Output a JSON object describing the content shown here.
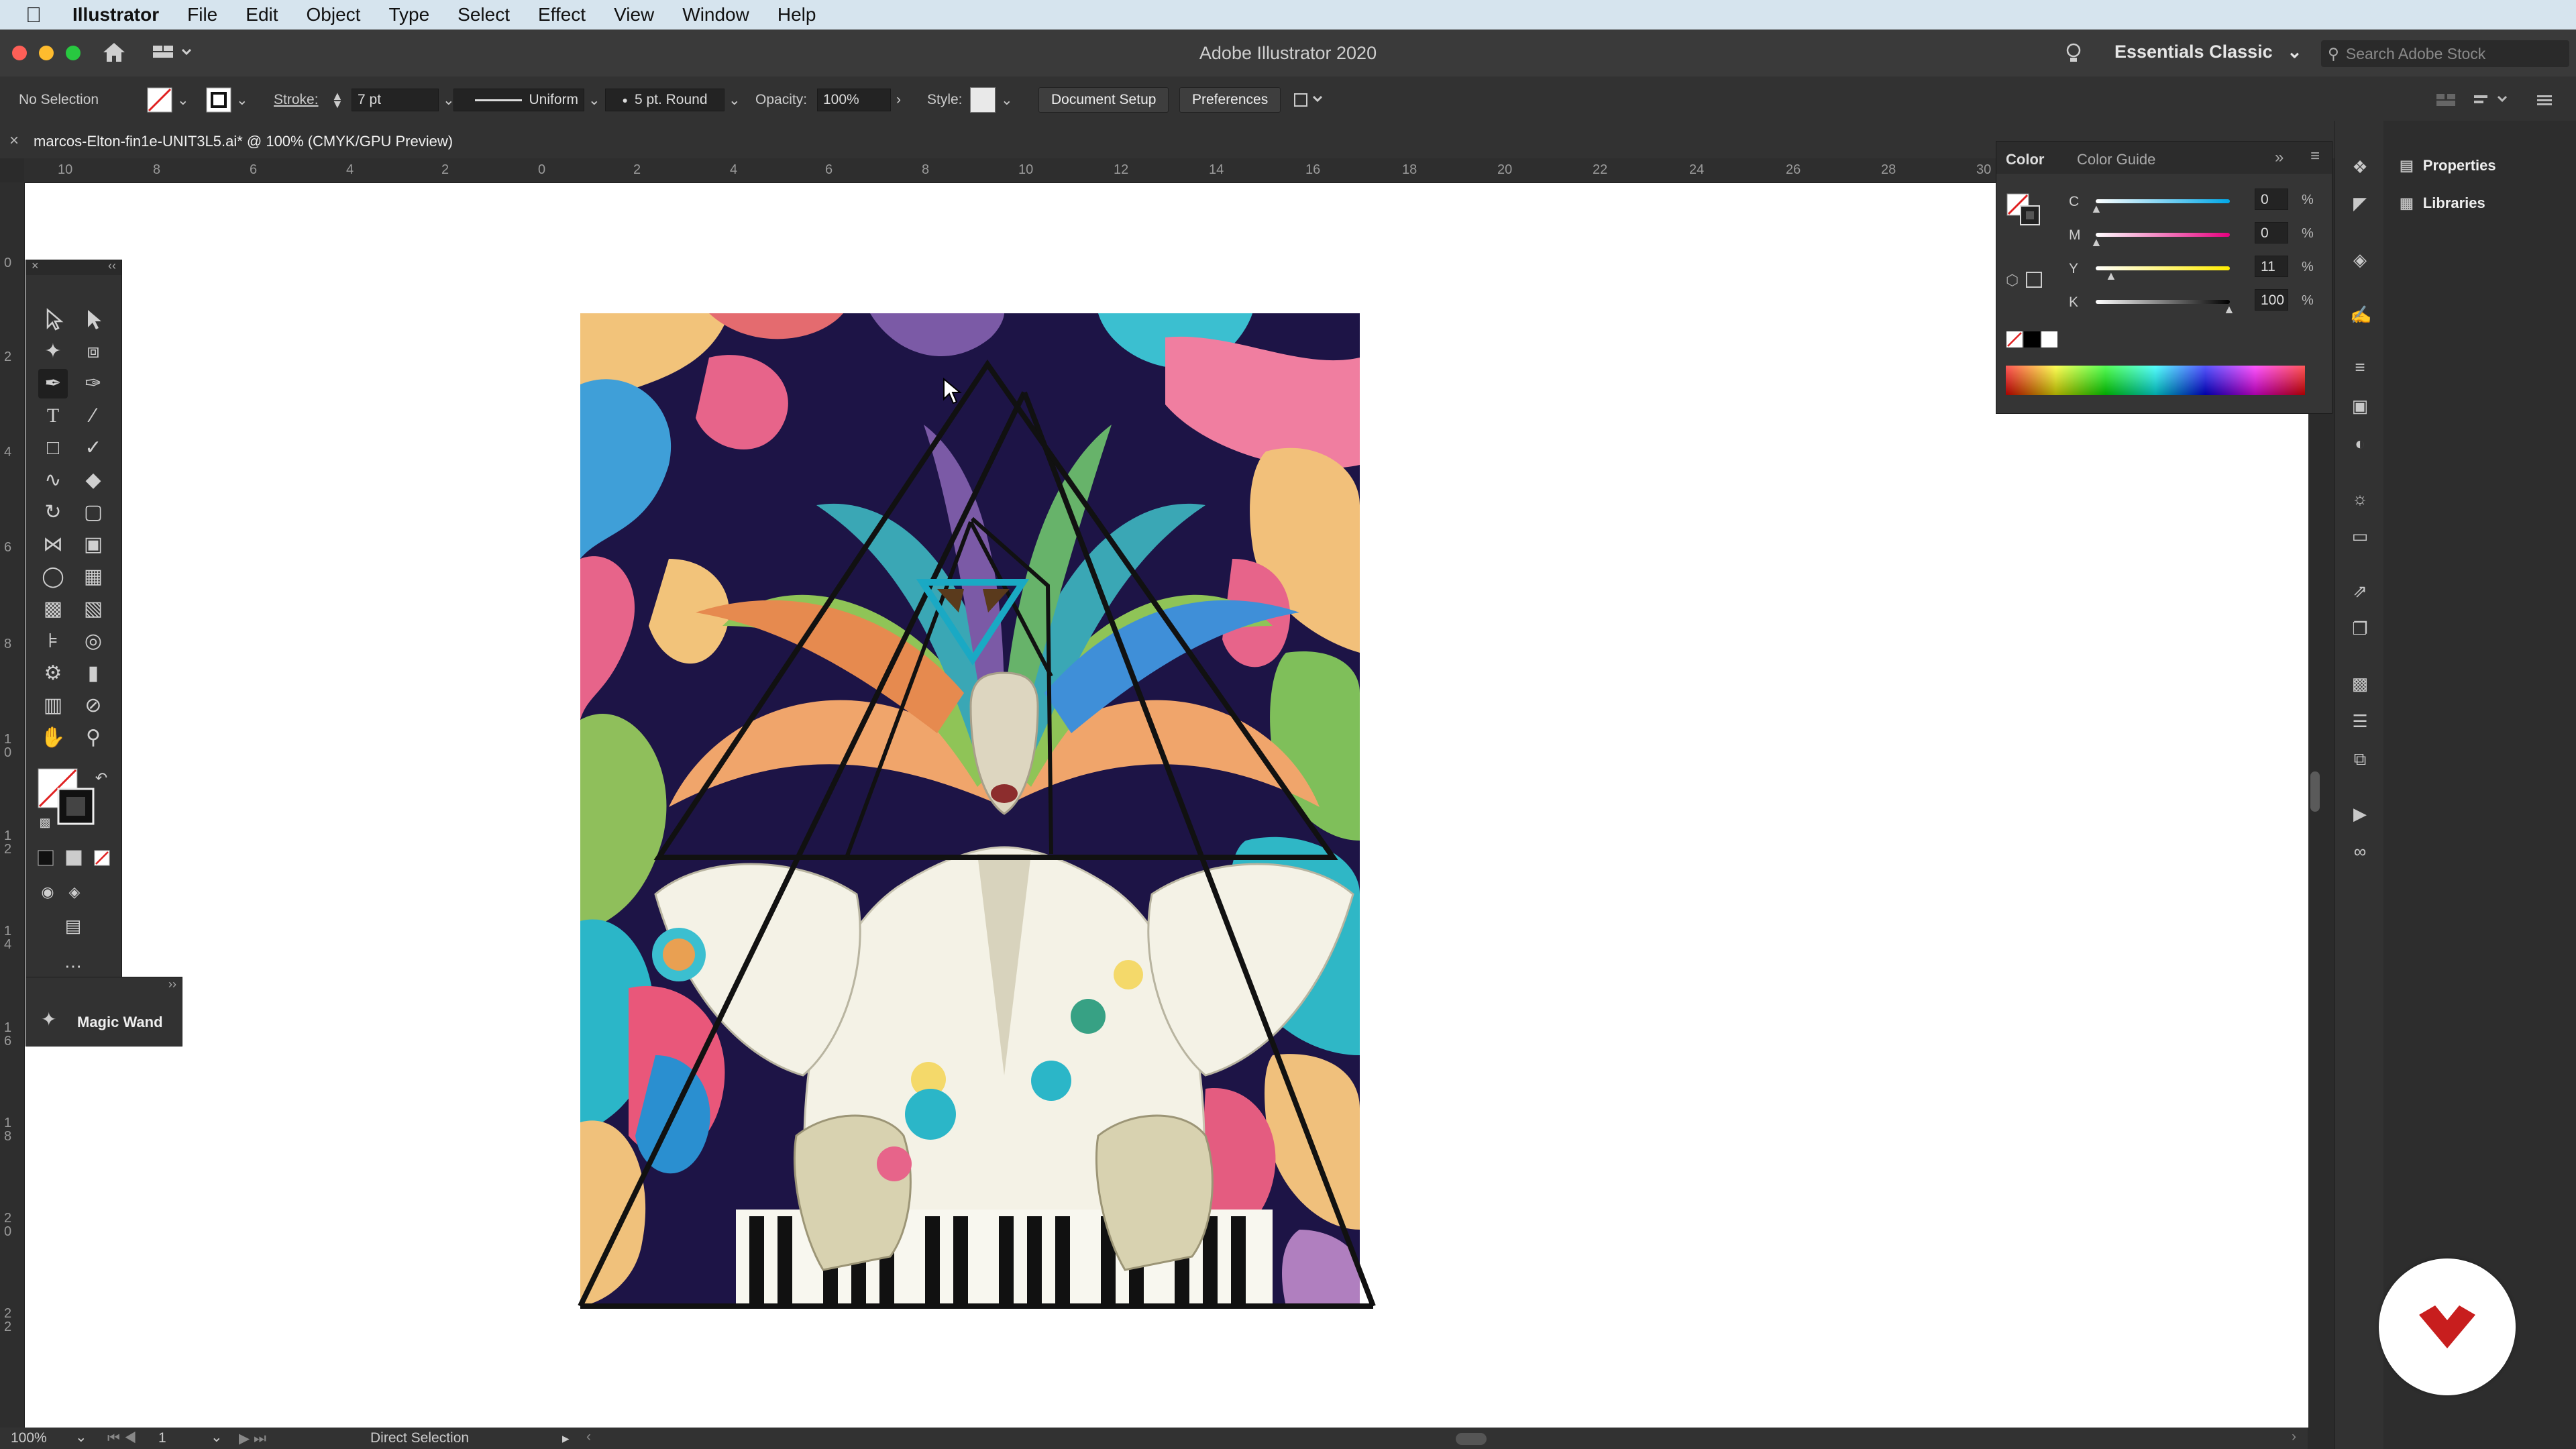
{
  "menubar": {
    "app": "Illustrator",
    "items": [
      "File",
      "Edit",
      "Object",
      "Type",
      "Select",
      "Effect",
      "View",
      "Window",
      "Help"
    ]
  },
  "titlebar": {
    "title": "Adobe Illustrator 2020",
    "workspace": "Essentials Classic",
    "search_placeholder": "Search Adobe Stock"
  },
  "controlbar": {
    "selection": "No Selection",
    "stroke_label": "Stroke:",
    "stroke_value": "7 pt",
    "profile": "Uniform",
    "brush": "5 pt. Round",
    "opacity_label": "Opacity:",
    "opacity_value": "100%",
    "style_label": "Style:",
    "document_setup": "Document Setup",
    "preferences": "Preferences"
  },
  "document": {
    "tab_title": "marcos-Elton-fin1e-UNIT3L5.ai* @ 100% (CMYK/GPU Preview)"
  },
  "ruler": {
    "h_labels": [
      "10",
      "8",
      "6",
      "4",
      "2",
      "0",
      "2",
      "4",
      "6",
      "8",
      "10",
      "12",
      "14",
      "16",
      "18",
      "20",
      "22",
      "24",
      "26",
      "28",
      "30"
    ],
    "v_labels": [
      "0",
      "2",
      "4",
      "6",
      "8",
      "10",
      "12",
      "14",
      "16",
      "18",
      "20",
      "22"
    ]
  },
  "color_panel": {
    "tab_color": "Color",
    "tab_guide": "Color Guide",
    "channels": [
      {
        "label": "C",
        "value": "0"
      },
      {
        "label": "M",
        "value": "0"
      },
      {
        "label": "Y",
        "value": "11"
      },
      {
        "label": "K",
        "value": "100"
      }
    ],
    "unit": "%"
  },
  "right_dock": {
    "properties": "Properties",
    "libraries": "Libraries"
  },
  "tools": {
    "tooltip_label": "Magic Wand"
  },
  "statusbar": {
    "zoom": "100%",
    "artboard": "1",
    "tool": "Direct Selection"
  },
  "colors": {
    "accent_cyan": "#1aa9c4",
    "artwork_navy": "#1d1446",
    "badge_red": "#c81e1e"
  }
}
